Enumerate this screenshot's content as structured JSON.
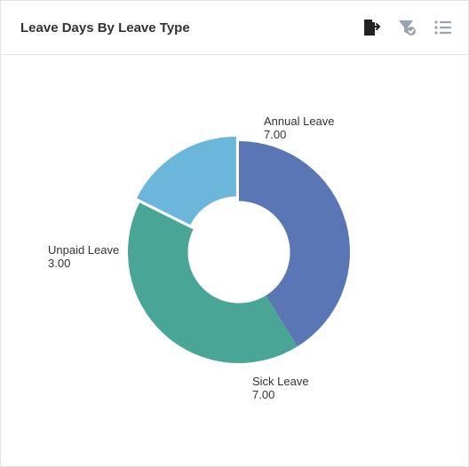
{
  "header": {
    "title": "Leave Days By Leave Type"
  },
  "icons": {
    "export": "export-icon",
    "filter": "filter-icon",
    "legend": "legend-icon"
  },
  "chart_data": {
    "type": "pie",
    "title": "Leave Days By Leave Type",
    "series": [
      {
        "name": "Annual Leave",
        "value": 7.0,
        "value_label": "7.00",
        "color": "#5a76b5"
      },
      {
        "name": "Sick Leave",
        "value": 7.0,
        "value_label": "7.00",
        "color": "#49a595"
      },
      {
        "name": "Unpaid Leave",
        "value": 3.0,
        "value_label": "3.00",
        "color": "#6bb7dc"
      }
    ],
    "donut": true,
    "inner_radius_ratio": 0.46
  },
  "labels": {
    "annual_name": "Annual Leave",
    "annual_value": "7.00",
    "sick_name": "Sick Leave",
    "sick_value": "7.00",
    "unpaid_name": "Unpaid Leave",
    "unpaid_value": "3.00"
  },
  "colors": {
    "muted_icon": "#9aa3ad",
    "dark_icon": "#222222"
  }
}
